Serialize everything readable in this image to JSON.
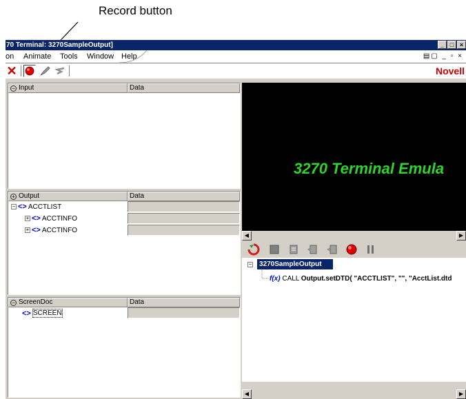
{
  "annotation": {
    "label": "Record button"
  },
  "window": {
    "title": "70 Terminal: 3270SampleOutput]"
  },
  "menu": {
    "items": [
      {
        "label": "on"
      },
      {
        "label": "Animate"
      },
      {
        "label": "Tools"
      },
      {
        "label": "Window"
      },
      {
        "label": "Help"
      }
    ]
  },
  "brand": "Novell",
  "panels": {
    "input": {
      "header": "Input",
      "data_header": "Data"
    },
    "output": {
      "header": "Output",
      "data_header": "Data",
      "nodes": [
        {
          "label": "ACCTLIST"
        },
        {
          "label": "ACCTINFO"
        },
        {
          "label": "ACCTINFO"
        }
      ]
    },
    "screendoc": {
      "header": "ScreenDoc",
      "data_header": "Data",
      "nodes": [
        {
          "label": "SCREEN"
        }
      ]
    }
  },
  "terminal": {
    "display_text": "3270 Terminal Emula"
  },
  "trace": {
    "root": "3270SampleOutput",
    "call_prefix": "f(x)",
    "call_keyword": "CALL",
    "call_text": "Output.setDTD( \"ACCTLIST\", \"\", \"AcctList.dtd"
  },
  "colors": {
    "title_bar": "#0a246a",
    "terminal_bg": "#000000",
    "terminal_text": "#2cd42c",
    "brand": "#cc0000",
    "record_red": "#e00000",
    "tag_blue": "#0000cc"
  },
  "icons": {
    "close": "close-icon",
    "record": "record-icon",
    "toolbar_tools": [
      "pen-icon",
      "undo-icon"
    ]
  }
}
